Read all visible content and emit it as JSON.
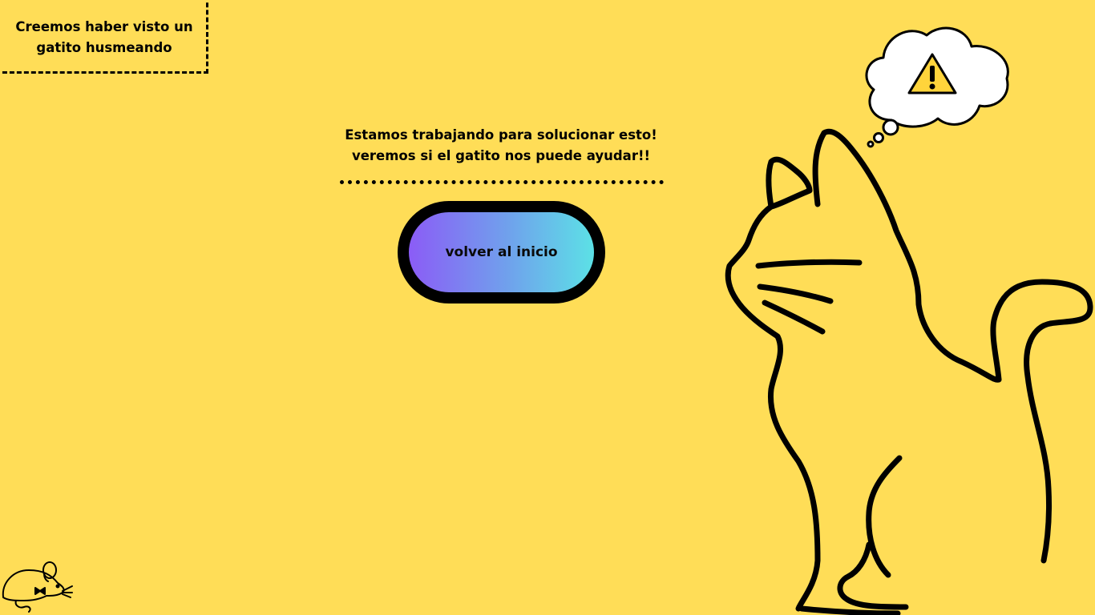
{
  "notice": {
    "line1": "Creemos haber visto un",
    "line2": "gatito husmeando"
  },
  "message": {
    "line1": "Estamos trabajando para solucionar esto!",
    "line2": "veremos si el gatito nos puede ayudar!!"
  },
  "home_button": {
    "label": "volver al inicio"
  },
  "colors": {
    "background": "#FFDD57",
    "button_gradient_start": "#8B5CF6",
    "button_gradient_end": "#5CE1E6",
    "warning": "#FFD43B"
  },
  "icons": {
    "warning": "warning-triangle-icon",
    "cat": "cat-illustration",
    "mouse": "mouse-icon"
  }
}
